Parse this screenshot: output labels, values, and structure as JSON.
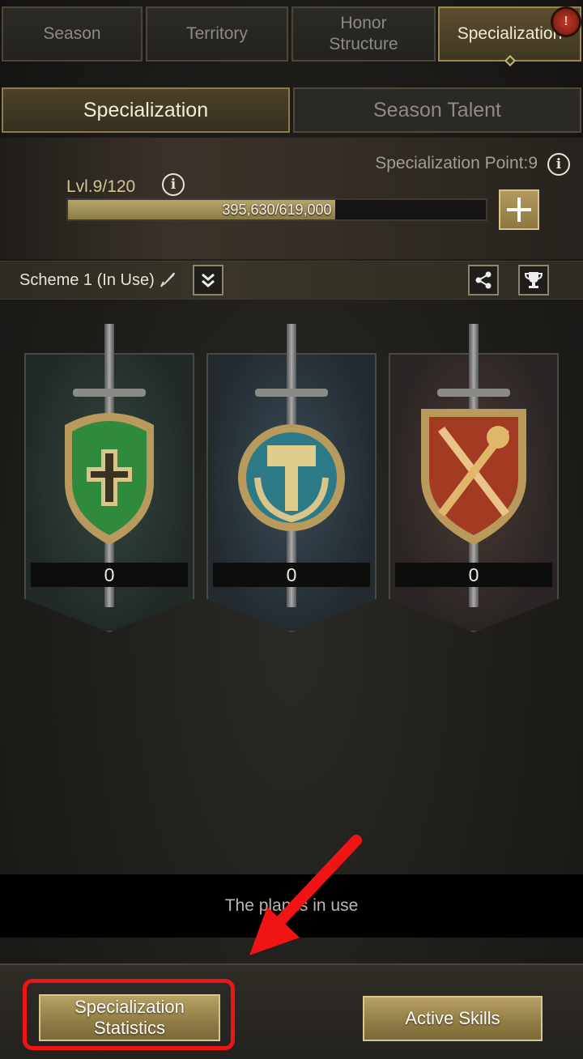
{
  "top_tabs": [
    {
      "label": "Season"
    },
    {
      "label": "Territory"
    },
    {
      "label": "Honor Structure"
    },
    {
      "label": "Specialization",
      "badge": "!"
    }
  ],
  "sub_tabs": [
    {
      "label": "Specialization"
    },
    {
      "label": "Season Talent"
    }
  ],
  "level_panel": {
    "spec_point": "Specialization Point:9",
    "level": "Lvl.9/120",
    "xp": "395,630/619,000",
    "xp_fraction": 0.639
  },
  "scheme": {
    "label": "Scheme 1 (In Use)"
  },
  "specializations": [
    {
      "name": "shield-cross",
      "count": "0",
      "color": "#2f6b3c"
    },
    {
      "name": "hammer-laurel",
      "count": "0",
      "color": "#2d5866"
    },
    {
      "name": "crossed-swords",
      "count": "0",
      "color": "#7a3324"
    }
  ],
  "message": "The plan is in use",
  "bottom": {
    "stats_label": "Specialization Statistics",
    "skills_label": "Active Skills"
  },
  "colors": {
    "accent_gold": "#b7a166",
    "annotation_red": "#f01414"
  }
}
